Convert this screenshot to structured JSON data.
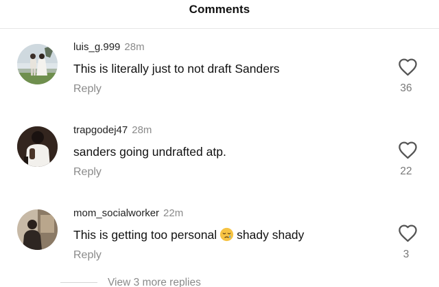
{
  "header": {
    "title": "Comments"
  },
  "comments": [
    {
      "username": "luis_g.999",
      "time": "28m",
      "text": "This is literally just to not draft Sanders",
      "reply": "Reply",
      "likes": "36",
      "icon": "heart-outline-icon"
    },
    {
      "username": "trapgodej47",
      "time": "28m",
      "text": "sanders going undrafted atp.",
      "reply": "Reply",
      "likes": "22",
      "icon": "heart-outline-icon"
    },
    {
      "username": "mom_socialworker",
      "time": "22m",
      "text_before": "This is getting too personal",
      "emoji": "😪",
      "text_after": "shady shady",
      "reply": "Reply",
      "likes": "3",
      "icon": "heart-outline-icon"
    }
  ],
  "footer": {
    "view_more": "View 3 more replies"
  },
  "colors": {
    "secondary_text": "#8a8a8a",
    "primary_text": "#111111",
    "divider": "#e6e6e6"
  }
}
